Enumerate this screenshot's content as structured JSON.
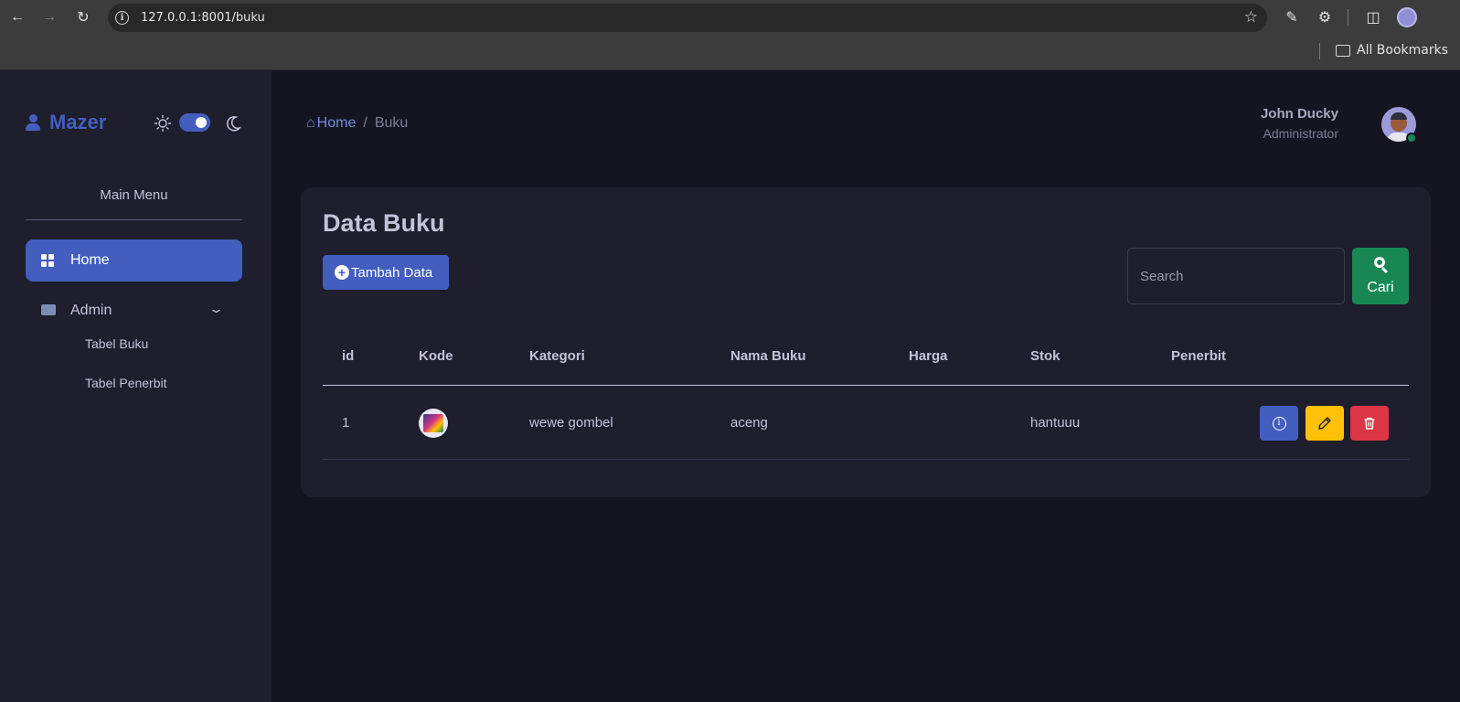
{
  "browser": {
    "url": "127.0.0.1:8001/buku",
    "bookmarks_label": "All Bookmarks"
  },
  "sidebar": {
    "logo": "Mazer",
    "menu_title": "Main Menu",
    "items": [
      {
        "label": "Home",
        "icon": "grid-icon",
        "active": true
      },
      {
        "label": "Admin",
        "icon": "briefcase-icon",
        "expanded": true
      }
    ],
    "subitems": [
      {
        "label": "Tabel Buku"
      },
      {
        "label": "Tabel Penerbit"
      }
    ]
  },
  "header": {
    "breadcrumb": {
      "home": "Home",
      "separator": "/",
      "current": "Buku"
    },
    "user": {
      "name": "John Ducky",
      "role": "Administrator"
    }
  },
  "card": {
    "title": "Data Buku",
    "add_button": "Tambah Data",
    "search_placeholder": "Search",
    "search_button": "Cari"
  },
  "table": {
    "columns": [
      "id",
      "Kode",
      "Kategori",
      "Nama Buku",
      "Harga",
      "Stok",
      "Penerbit"
    ],
    "rows": [
      {
        "id": "1",
        "kode": "",
        "kategori": "wewe gombel",
        "nama_buku": "aceng",
        "harga": "",
        "stok": "hantuuu",
        "penerbit": ""
      }
    ]
  },
  "colors": {
    "primary": "#435ebe",
    "success": "#198754",
    "warning": "#ffc107",
    "danger": "#dc3545",
    "background": "#151521",
    "surface": "#1e1e2d"
  }
}
